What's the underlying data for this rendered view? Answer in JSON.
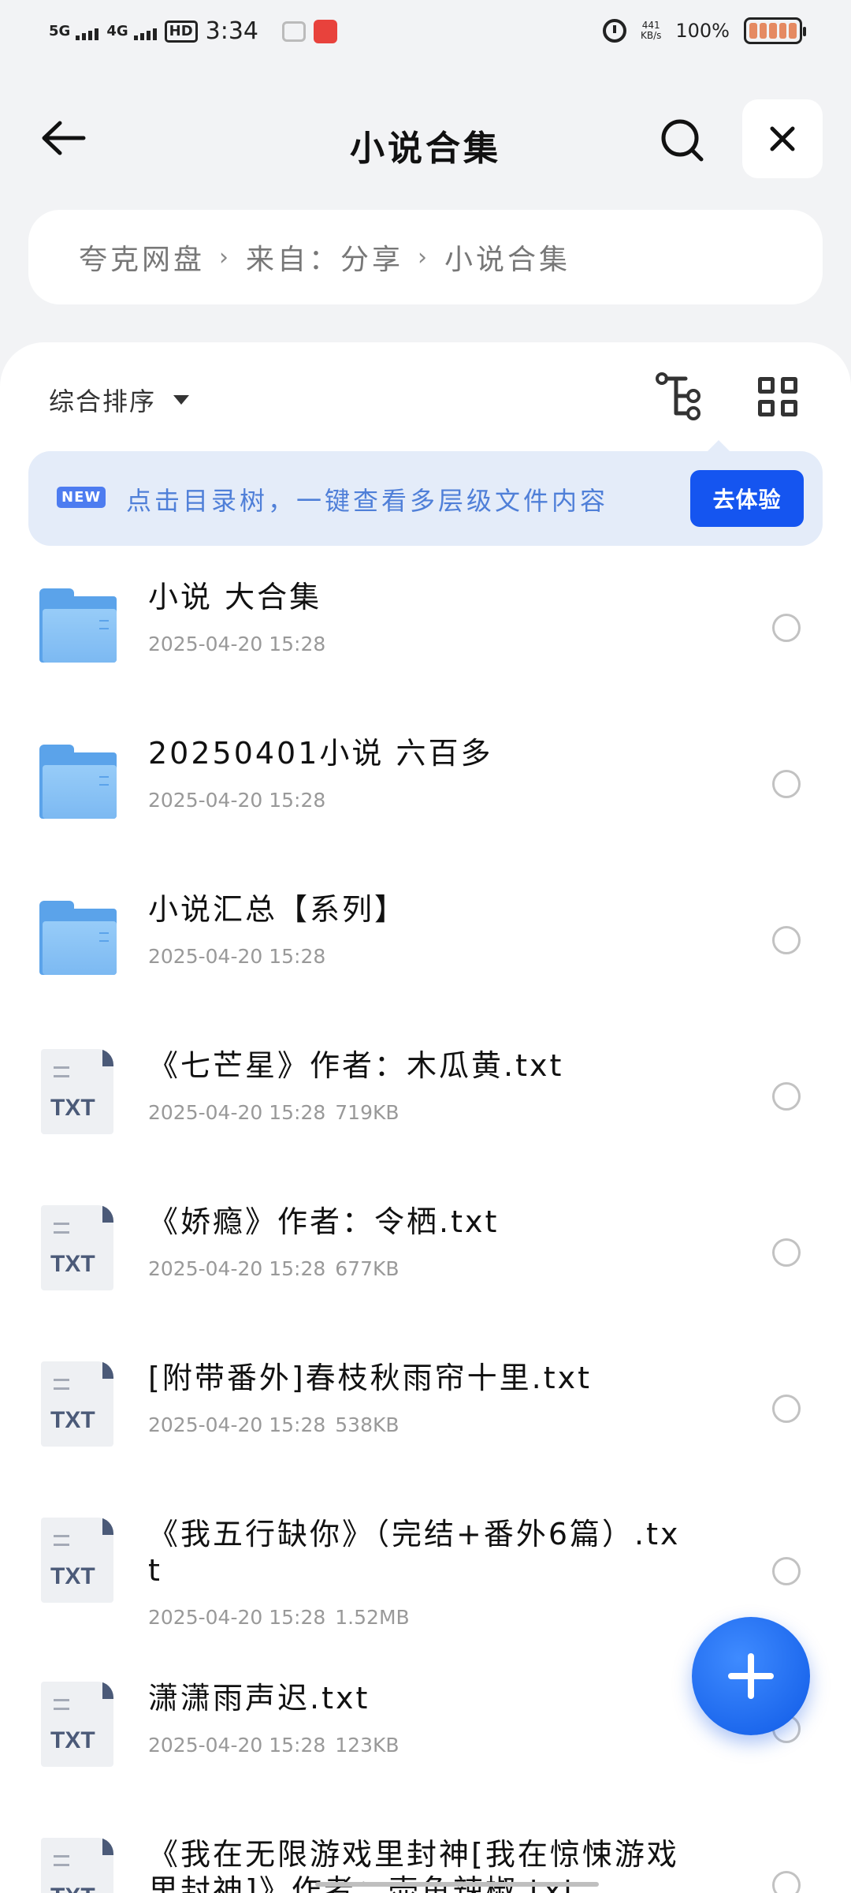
{
  "status_bar": {
    "network1": "5G",
    "network2": "4G",
    "hd": "HD",
    "time": "3:34",
    "speed_value": "441",
    "speed_unit": "KB/s",
    "battery": "100%"
  },
  "header": {
    "title": "小说合集"
  },
  "breadcrumb": [
    "夸克网盘",
    "来自：分享",
    "小说合集"
  ],
  "toolbar": {
    "sort_label": "综合排序"
  },
  "tip": {
    "badge": "NEW",
    "text": "点击目录树，一键查看多层级文件内容",
    "button": "去体验"
  },
  "files": [
    {
      "type": "folder",
      "name": "小说 大合集",
      "date": "2025-04-20 15:28",
      "size": ""
    },
    {
      "type": "folder",
      "name": "20250401小说 六百多",
      "date": "2025-04-20 15:28",
      "size": ""
    },
    {
      "type": "folder",
      "name": "小说汇总【系列】",
      "date": "2025-04-20 15:28",
      "size": ""
    },
    {
      "type": "txt",
      "name": "《七芒星》作者：木瓜黄.txt",
      "date": "2025-04-20 15:28",
      "size": "719KB"
    },
    {
      "type": "txt",
      "name": "《娇瘾》作者：令栖.txt",
      "date": "2025-04-20 15:28",
      "size": "677KB"
    },
    {
      "type": "txt",
      "name": "[附带番外]春枝秋雨帘十里.txt",
      "date": "2025-04-20 15:28",
      "size": "538KB"
    },
    {
      "type": "txt",
      "name": "《我五行缺你》（完结+番外6篇）.txt",
      "date": "2025-04-20 15:28",
      "size": "1.52MB"
    },
    {
      "type": "txt",
      "name": "潇潇雨声迟.txt",
      "date": "2025-04-20 15:28",
      "size": "123KB"
    },
    {
      "type": "txt",
      "name": "《我在无限游戏里封神[我在惊悚游戏里封神]》作者：壶鱼辣椒.txt",
      "date": "",
      "size": ""
    }
  ],
  "file_icon_label": "TXT"
}
